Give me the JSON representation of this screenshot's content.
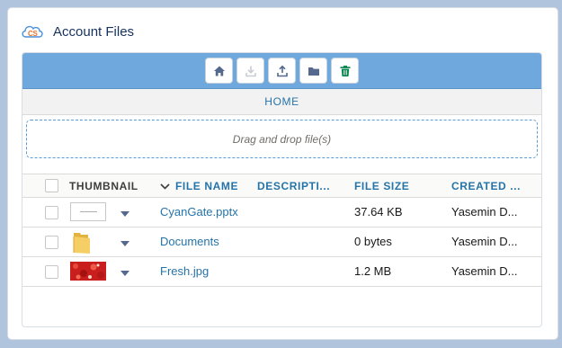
{
  "card": {
    "title": "Account Files",
    "logo_icon": "cs-cloud-logo-icon"
  },
  "toolbar": {
    "buttons": [
      {
        "icon": "home-icon",
        "enabled": true
      },
      {
        "icon": "download-icon",
        "enabled": false
      },
      {
        "icon": "upload-icon",
        "enabled": true
      },
      {
        "icon": "folder-icon",
        "enabled": true
      },
      {
        "icon": "trash-icon",
        "enabled": true,
        "color": "#04844b"
      }
    ]
  },
  "breadcrumb": {
    "label": "HOME"
  },
  "dropzone": {
    "text": "Drag and drop file(s)"
  },
  "table": {
    "columns": {
      "thumbnail": "THUMBNAIL",
      "file_name": "FILE NAME",
      "description": "DESCRIPTI...",
      "file_size": "FILE SIZE",
      "created": "CREATED ..."
    },
    "rows": [
      {
        "thumbnail": "slide-thumbnail",
        "name": "CyanGate.pptx",
        "description": "",
        "size": "37.64 KB",
        "created": "Yasemin D..."
      },
      {
        "thumbnail": "folder-thumbnail",
        "name": "Documents",
        "description": "",
        "size": "0 bytes",
        "created": "Yasemin D..."
      },
      {
        "thumbnail": "image-thumbnail",
        "name": "Fresh.jpg",
        "description": "",
        "size": "1.2 MB",
        "created": "Yasemin D..."
      }
    ]
  },
  "colors": {
    "toolbar_bg": "#6fa8dc",
    "link": "#2574a9",
    "trash": "#04844b",
    "page_bg": "#b0c4de"
  }
}
